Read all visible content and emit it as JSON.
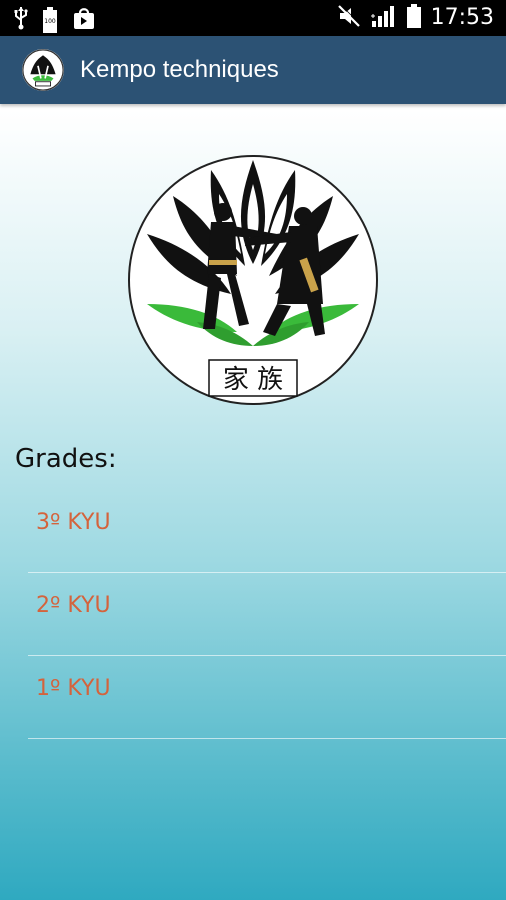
{
  "status_bar": {
    "time": "17:53",
    "left_icons": [
      "usb-icon",
      "battery-full-icon",
      "store-bag-icon"
    ],
    "right_icons": [
      "mute-icon",
      "signal-icon",
      "battery-icon"
    ],
    "battery_notification_label": "100"
  },
  "app_bar": {
    "title": "Kempo techniques",
    "logo_icon": "kempo-logo-icon",
    "color": "#2c5274"
  },
  "logo": {
    "caption": "家 族"
  },
  "grades": {
    "label": "Grades:",
    "items": [
      {
        "label": "3º KYU"
      },
      {
        "label": "2º KYU"
      },
      {
        "label": "1º KYU"
      }
    ],
    "item_color": "#d4633c"
  }
}
